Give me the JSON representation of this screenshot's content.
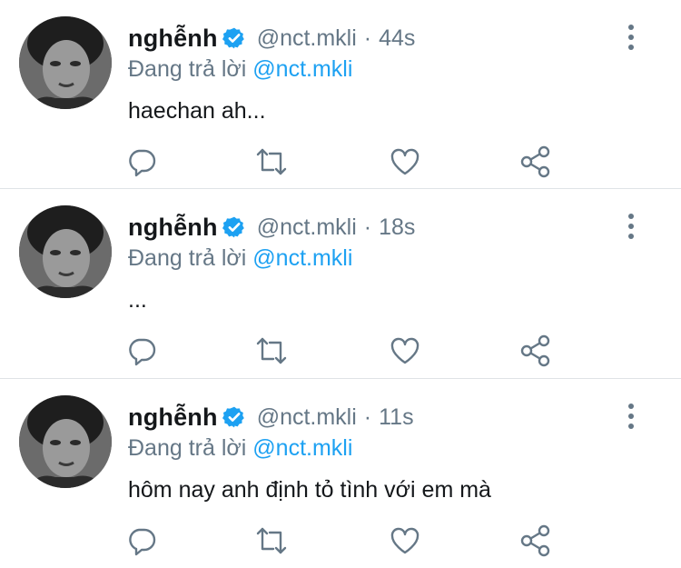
{
  "colors": {
    "text_primary": "#14171a",
    "text_secondary": "#657786",
    "accent": "#1da1f2",
    "divider": "#dfe3e6"
  },
  "tweets": [
    {
      "author_name": "nghễnh",
      "handle": "@nct.mkli",
      "separator": "·",
      "time": "44s",
      "replying_prefix": "Đang trả lời",
      "replying_to": "@nct.mkli",
      "text": "haechan ah...",
      "icons": [
        "verified-badge-icon",
        "more-vertical-icon",
        "reply-icon",
        "retweet-icon",
        "like-icon",
        "share-icon"
      ]
    },
    {
      "author_name": "nghễnh",
      "handle": "@nct.mkli",
      "separator": "·",
      "time": "18s",
      "replying_prefix": "Đang trả lời",
      "replying_to": "@nct.mkli",
      "text": "...",
      "icons": [
        "verified-badge-icon",
        "more-vertical-icon",
        "reply-icon",
        "retweet-icon",
        "like-icon",
        "share-icon"
      ]
    },
    {
      "author_name": "nghễnh",
      "handle": "@nct.mkli",
      "separator": "·",
      "time": "11s",
      "replying_prefix": "Đang trả lời",
      "replying_to": "@nct.mkli",
      "text": "hôm nay anh định tỏ tình với em mà",
      "icons": [
        "verified-badge-icon",
        "more-vertical-icon",
        "reply-icon",
        "retweet-icon",
        "like-icon",
        "share-icon"
      ]
    }
  ]
}
